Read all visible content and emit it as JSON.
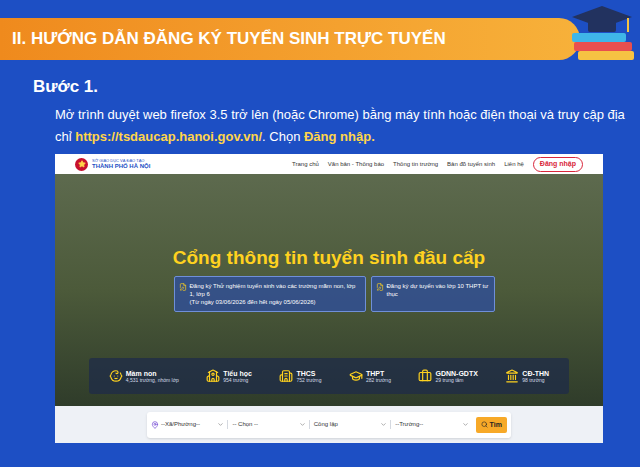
{
  "banner": {
    "title": "II. HƯỚNG DẪN ĐĂNG KÝ TUYỂN SINH TRỰC TUYẾN"
  },
  "step": {
    "title": "Bước 1.",
    "text": [
      {
        "text": "Mở trình duyệt web firefox 3.5 trở lên (hoặc Chrome) bằng máy tính hoặc điện thoại và truy cập địa chỉ ",
        "highlight": false
      },
      {
        "text": "https://tsdaucap.hanoi.gov.vn/",
        "highlight": true
      },
      {
        "text": ". Chọn ",
        "highlight": false
      },
      {
        "text": "Đăng nhập.",
        "highlight": true
      }
    ]
  },
  "site": {
    "org_line1": "SỞ GIÁO DỤC VÀ ĐÀO TẠO",
    "org_line2": "THÀNH PHỐ HÀ NỘI",
    "nav": [
      "Trang chủ",
      "Văn bản - Thông báo",
      "Thông tin trường",
      "Bản đồ tuyển sinh",
      "Liên hệ"
    ],
    "login": "Đăng nhập",
    "hero_title": "Cổng thông tin tuyển sinh đầu cấp",
    "cards": [
      {
        "text": "Đăng ký Thử nghiệm tuyển sinh vào các trường mầm non, lớp 1, lớp 6",
        "subtext": "(Từ ngày 03/06/2026 đến hết ngày 05/06/2026)"
      },
      {
        "text": "Đăng ký dự tuyển vào lớp 10 THPT tư thục",
        "subtext": ""
      }
    ],
    "categories": [
      {
        "name": "Mầm non",
        "count": "4,531 trường, nhóm lớp"
      },
      {
        "name": "Tiểu học",
        "count": "954 trường"
      },
      {
        "name": "THCS",
        "count": "752 trường"
      },
      {
        "name": "THPT",
        "count": "282 trường"
      },
      {
        "name": "GDNN-GDTX",
        "count": "29 trung tâm"
      },
      {
        "name": "CĐ-THN",
        "count": "98 trường"
      }
    ],
    "search": {
      "fields": [
        "--Xã/Phường--",
        "-- Chọn --",
        "Công lập",
        "--Trường--"
      ],
      "button": "Tìm"
    }
  }
}
